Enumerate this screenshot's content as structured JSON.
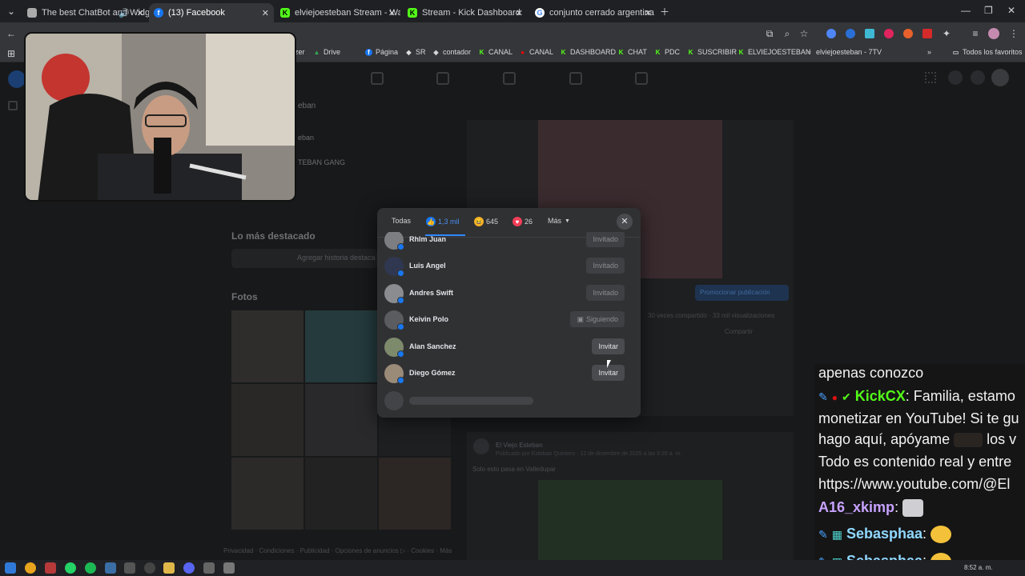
{
  "tabs": [
    {
      "title": "The best ChatBot and Widg",
      "active": false
    },
    {
      "title": "(13) Facebook",
      "active": true
    },
    {
      "title": "elviejoesteban Stream - Watch",
      "active": false
    },
    {
      "title": "Stream - Kick Dashboard",
      "active": false
    },
    {
      "title": "conjunto cerrado argentina vall",
      "active": false
    }
  ],
  "bookmarks": {
    "items": [
      "zer",
      "Drive",
      "Página",
      "SR",
      "contador",
      "CANAL",
      "CANAL",
      "DASHBOARD",
      "CHAT",
      "PDC",
      "SUSCRIBIR",
      "ELVIEJOESTEBAN",
      "elviejoesteban - 7TV"
    ],
    "all_favorites": "Todos los favoritos"
  },
  "page": {
    "profile_name": "eban",
    "sidebar_line_1": "eban",
    "sidebar_line_2": "TEBAN GANG",
    "highlights_title": "Lo más destacado",
    "add_highlight": "Agregar historia destaca",
    "photos_title": "Fotos",
    "promote_button": "Promocionar publicación",
    "shares_stats": "30 veces compartido · 33 mil visualizaciones",
    "share_label": "Compartir",
    "post2_author": "El Viejo Esteban",
    "post2_meta": "Publicado por Esteban Quintero · 12 de diciembre de 2025 a las 9:20 a. m.",
    "post2_text": "Solo esto pasa en Valledupar",
    "footer_links": "Privacidad · Condiciones · Publicidad · Opciones de anuncios ▷ · Cookies · Más"
  },
  "modal": {
    "tab_all": "Todas",
    "tab_like_count": "1,3 mil",
    "tab_haha_count": "645",
    "tab_love_count": "26",
    "tab_more": "Más",
    "rows": [
      {
        "name": "Rhlm Juan",
        "action": "Invitado"
      },
      {
        "name": "Luis Angel",
        "action": "Invitado"
      },
      {
        "name": "Andres Swift",
        "action": "Invitado"
      },
      {
        "name": "Keivin Polo",
        "action": "Siguiendo"
      },
      {
        "name": "Alan Sanchez",
        "action": "Invitar"
      },
      {
        "name": "Diego Gómez",
        "action": "Invitar"
      }
    ]
  },
  "chat": {
    "line1": "apenas conozco",
    "line2_user": "KickCX",
    "line2_text": ": Familia, estamo",
    "line3": "monetizar en YouTube! Si te gu",
    "line4_a": "hago aquí, apóyame",
    "line4_b": "los v",
    "line5": "Todo es contenido real y entre",
    "line6": "https://www.youtube.com/@El",
    "line7_user": "A16_xkimp",
    "line8_user": "Sebasphaa",
    "line9_user": "Sebasphaa"
  },
  "taskbar": {
    "clock": "8:52 a. m."
  },
  "colors": {
    "like_blue": "#1877f2",
    "kick_green": "#53fc18",
    "love_red": "#f33e58",
    "haha_yellow": "#f7b125"
  }
}
